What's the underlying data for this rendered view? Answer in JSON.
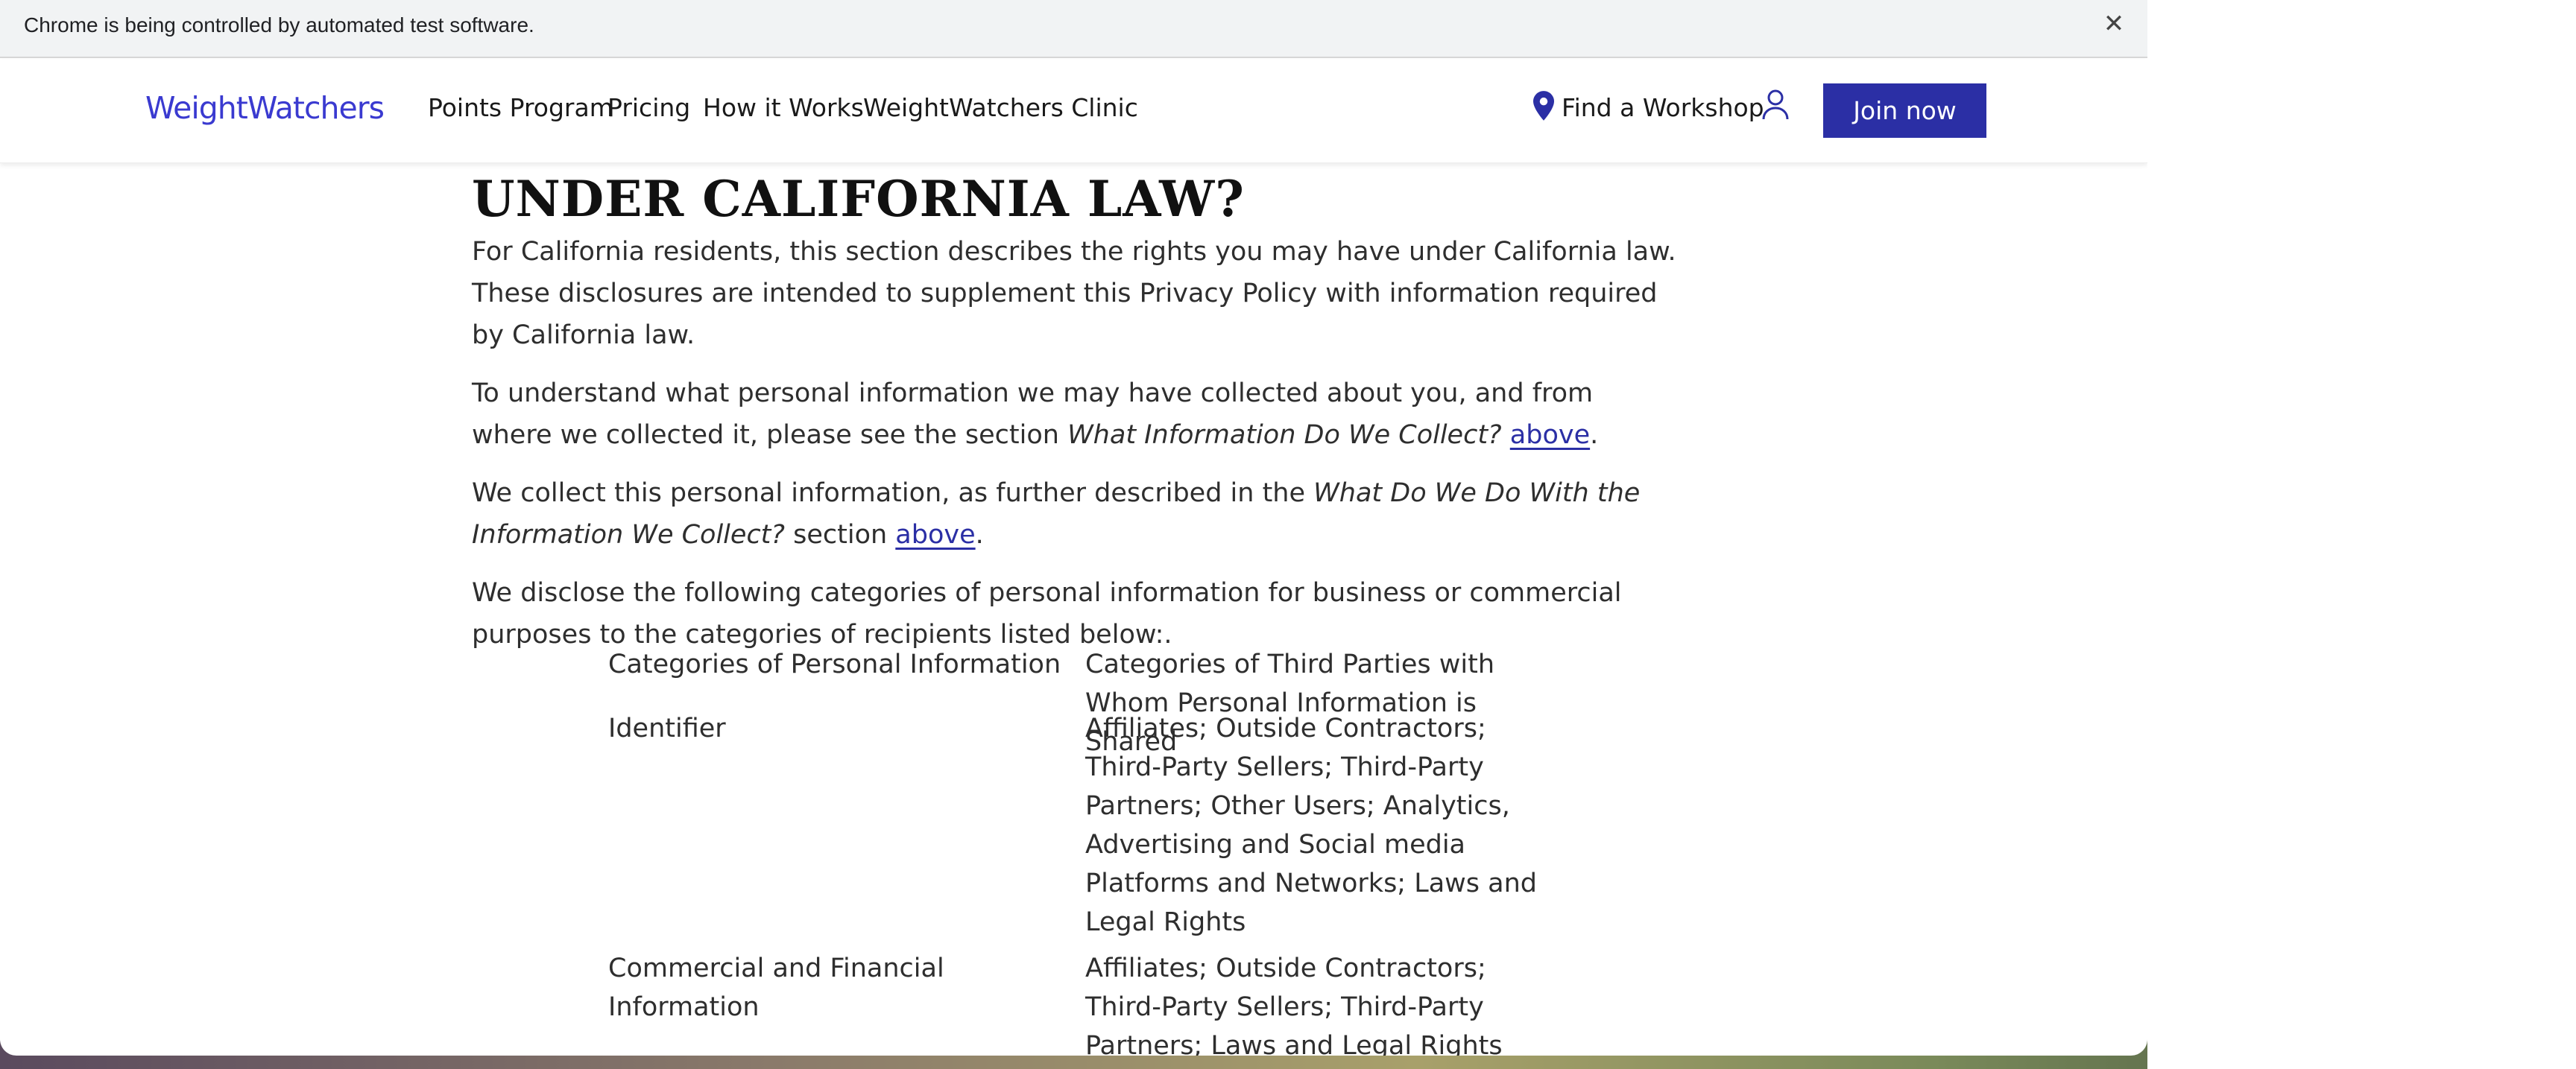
{
  "browser": {
    "infobar_text": "Chrome is being controlled by automated test software.",
    "close_glyph": "✕"
  },
  "nav": {
    "logo": "WeightWatchers",
    "links": [
      "Points Program",
      "Pricing",
      "How it Works",
      "WeightWatchers Clinic"
    ],
    "workshop": "Find a Workshop",
    "join": "Join now"
  },
  "content": {
    "heading": "UNDER CALIFORNIA LAW?",
    "p1": "For California residents, this section describes the rights you may have under California law. These disclosures are intended to supplement this Privacy Policy with information required by California law.",
    "p2_pre": "To understand what personal information we may have collected about you, and from where we collected it, please see the section ",
    "p2_em": "What Information Do We Collect?",
    "p2_link": "above",
    "p2_post": ".",
    "p3_pre": "We collect this personal information, as further described in the ",
    "p3_em": "What Do We Do With the Information We Collect?",
    "p3_mid": " section ",
    "p3_link": "above",
    "p3_post": ".",
    "p4": "We disclose the following categories of personal information for business or commercial purposes to the categories of recipients listed below:."
  },
  "table": {
    "headers": [
      "Categories of Personal Information",
      "Categories of Third Parties with Whom Personal Information is Shared"
    ],
    "rows": [
      [
        "Identifier",
        "Affiliates; Outside Contractors; Third-Party Sellers; Third-Party Partners; Other Users; Analytics, Advertising and Social media Platforms and Networks; Laws and Legal Rights"
      ],
      [
        "Commercial and Financial Information",
        "Affiliates; Outside Contractors; Third-Party Sellers; Third-Party Partners; Laws and Legal Rights"
      ]
    ]
  },
  "colors": {
    "brand": "#3a3ad0",
    "button": "#2b2fa5",
    "link": "#2b2fa5"
  },
  "icons": [
    "close-icon",
    "location-pin-icon",
    "user-icon"
  ]
}
